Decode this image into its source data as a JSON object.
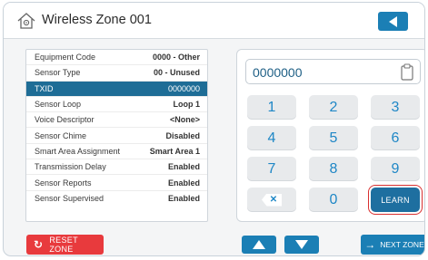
{
  "header": {
    "title": "Wireless Zone 001",
    "home_icon": "home-settings-icon",
    "back_icon": "back-arrow-icon"
  },
  "settings": [
    {
      "label": "Equipment Code",
      "value": "0000 - Other",
      "selected": false
    },
    {
      "label": "Sensor Type",
      "value": "00 - Unused",
      "selected": false
    },
    {
      "label": "TXID",
      "value": "0000000",
      "selected": true
    },
    {
      "label": "Sensor Loop",
      "value": "Loop 1",
      "selected": false
    },
    {
      "label": "Voice Descriptor",
      "value": "<None>",
      "selected": false
    },
    {
      "label": "Sensor Chime",
      "value": "Disabled",
      "selected": false
    },
    {
      "label": "Smart Area Assignment",
      "value": "Smart Area 1",
      "selected": false
    },
    {
      "label": "Transmission Delay",
      "value": "Enabled",
      "selected": false
    },
    {
      "label": "Sensor Reports",
      "value": "Enabled",
      "selected": false
    },
    {
      "label": "Sensor Supervised",
      "value": "Enabled",
      "selected": false
    }
  ],
  "keypad": {
    "input_value": "0000000",
    "clipboard_icon": "clipboard-icon",
    "keys": [
      "1",
      "2",
      "3",
      "4",
      "5",
      "6",
      "7",
      "8",
      "9"
    ],
    "delete_icon": "backspace-icon",
    "zero": "0",
    "learn_label": "LEARN"
  },
  "footer": {
    "reset_label": "RESET ZONE",
    "reset_icon": "refresh-icon",
    "up_icon": "arrow-up-icon",
    "down_icon": "arrow-down-icon",
    "next_label": "NEXT ZONE",
    "next_icon": "arrow-right-icon"
  },
  "colors": {
    "accent": "#1b7fb5",
    "selected_row": "#1e6d96",
    "danger": "#e83a3d",
    "key_text": "#1f87c6"
  }
}
